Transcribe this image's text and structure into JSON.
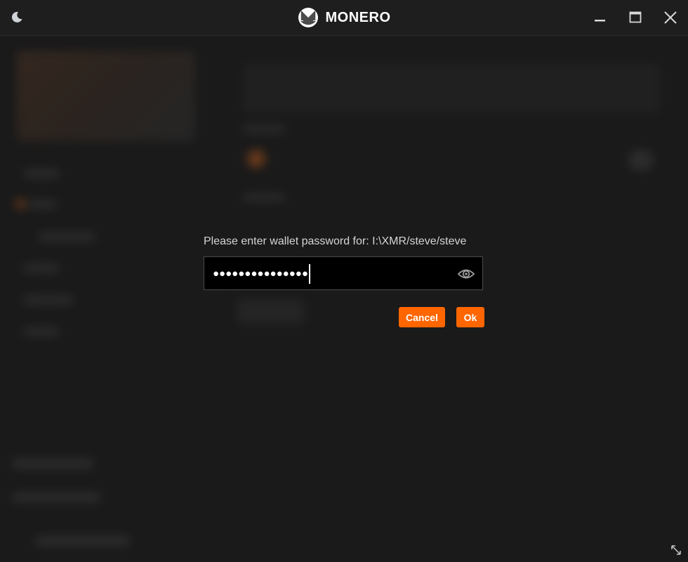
{
  "app": {
    "title": "MONERO",
    "theme_icon": "moon-icon",
    "logo_icon": "monero-logo-icon"
  },
  "window_controls": {
    "minimize_icon": "minimize-icon",
    "maximize_icon": "maximize-icon",
    "close_icon": "close-icon"
  },
  "dialog": {
    "prompt": "Please enter wallet password for: I:\\XMR/steve/steve",
    "password_masked": "●●●●●●●●●●●●●●●",
    "toggle_visibility_icon": "eye-icon",
    "cancel_label": "Cancel",
    "ok_label": "Ok"
  },
  "colors": {
    "accent": "#ff6600",
    "background": "#1a1a1a",
    "field_background": "#000000"
  }
}
